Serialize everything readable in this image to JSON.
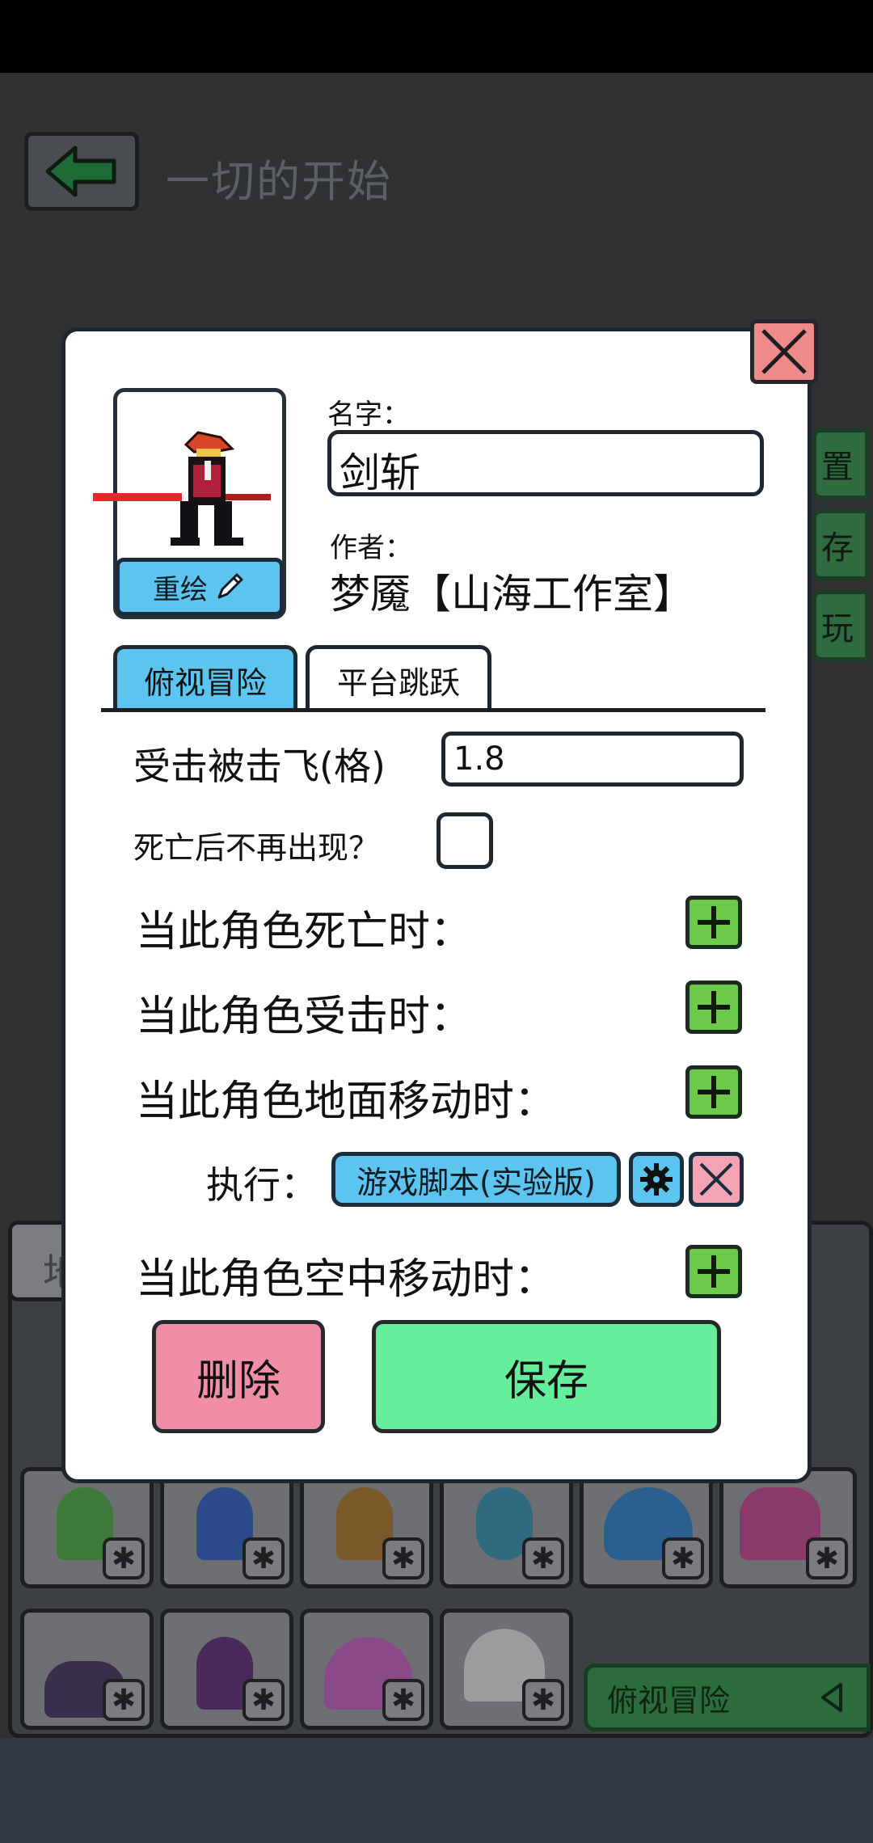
{
  "page": {
    "title": "一切的开始"
  },
  "side_buttons": [
    "置",
    "存",
    "玩"
  ],
  "grid": {
    "tab_label": "地",
    "mode_label": "俯视冒险"
  },
  "dialog": {
    "name_label": "名字：",
    "name_value": "剑斩",
    "author_label": "作者：",
    "author_value": "梦魇【山海工作室】",
    "redraw_label": "重绘",
    "tabs": [
      "俯视冒险",
      "平台跳跃"
    ],
    "knockback_label": "受击被击飞(格)",
    "knockback_value": "1.8",
    "no_respawn_label": "死亡后不再出现？",
    "no_respawn_checked": false,
    "events": {
      "on_death": "当此角色死亡时：",
      "on_hit": "当此角色受击时：",
      "on_ground_move": "当此角色地面移动时：",
      "on_air_move": "当此角色空中移动时："
    },
    "execute_label": "执行：",
    "script_name": "游戏脚本(实验版)",
    "delete_label": "删除",
    "save_label": "保存"
  },
  "colors": {
    "accent_blue": "#5bc4ef",
    "plus_green": "#6cc949",
    "save_green": "#65ef9c",
    "delete_pink": "#f08ea6",
    "close_red": "#ee8a8a"
  }
}
